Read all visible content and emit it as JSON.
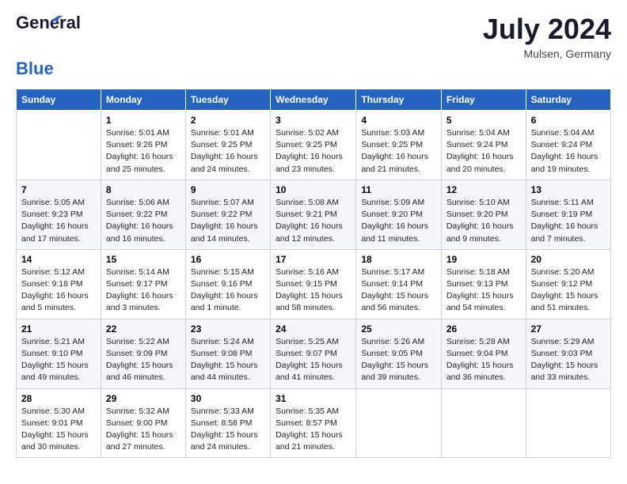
{
  "header": {
    "logo_general": "General",
    "logo_blue": "Blue",
    "month": "July 2024",
    "location": "Mulsen, Germany"
  },
  "columns": [
    "Sunday",
    "Monday",
    "Tuesday",
    "Wednesday",
    "Thursday",
    "Friday",
    "Saturday"
  ],
  "weeks": [
    {
      "cells": [
        {
          "date": "",
          "info": ""
        },
        {
          "date": "1",
          "info": "Sunrise: 5:01 AM\nSunset: 9:26 PM\nDaylight: 16 hours\nand 25 minutes."
        },
        {
          "date": "2",
          "info": "Sunrise: 5:01 AM\nSunset: 9:25 PM\nDaylight: 16 hours\nand 24 minutes."
        },
        {
          "date": "3",
          "info": "Sunrise: 5:02 AM\nSunset: 9:25 PM\nDaylight: 16 hours\nand 23 minutes."
        },
        {
          "date": "4",
          "info": "Sunrise: 5:03 AM\nSunset: 9:25 PM\nDaylight: 16 hours\nand 21 minutes."
        },
        {
          "date": "5",
          "info": "Sunrise: 5:04 AM\nSunset: 9:24 PM\nDaylight: 16 hours\nand 20 minutes."
        },
        {
          "date": "6",
          "info": "Sunrise: 5:04 AM\nSunset: 9:24 PM\nDaylight: 16 hours\nand 19 minutes."
        }
      ]
    },
    {
      "cells": [
        {
          "date": "7",
          "info": "Sunrise: 5:05 AM\nSunset: 9:23 PM\nDaylight: 16 hours\nand 17 minutes."
        },
        {
          "date": "8",
          "info": "Sunrise: 5:06 AM\nSunset: 9:22 PM\nDaylight: 16 hours\nand 16 minutes."
        },
        {
          "date": "9",
          "info": "Sunrise: 5:07 AM\nSunset: 9:22 PM\nDaylight: 16 hours\nand 14 minutes."
        },
        {
          "date": "10",
          "info": "Sunrise: 5:08 AM\nSunset: 9:21 PM\nDaylight: 16 hours\nand 12 minutes."
        },
        {
          "date": "11",
          "info": "Sunrise: 5:09 AM\nSunset: 9:20 PM\nDaylight: 16 hours\nand 11 minutes."
        },
        {
          "date": "12",
          "info": "Sunrise: 5:10 AM\nSunset: 9:20 PM\nDaylight: 16 hours\nand 9 minutes."
        },
        {
          "date": "13",
          "info": "Sunrise: 5:11 AM\nSunset: 9:19 PM\nDaylight: 16 hours\nand 7 minutes."
        }
      ]
    },
    {
      "cells": [
        {
          "date": "14",
          "info": "Sunrise: 5:12 AM\nSunset: 9:18 PM\nDaylight: 16 hours\nand 5 minutes."
        },
        {
          "date": "15",
          "info": "Sunrise: 5:14 AM\nSunset: 9:17 PM\nDaylight: 16 hours\nand 3 minutes."
        },
        {
          "date": "16",
          "info": "Sunrise: 5:15 AM\nSunset: 9:16 PM\nDaylight: 16 hours\nand 1 minute."
        },
        {
          "date": "17",
          "info": "Sunrise: 5:16 AM\nSunset: 9:15 PM\nDaylight: 15 hours\nand 58 minutes."
        },
        {
          "date": "18",
          "info": "Sunrise: 5:17 AM\nSunset: 9:14 PM\nDaylight: 15 hours\nand 56 minutes."
        },
        {
          "date": "19",
          "info": "Sunrise: 5:18 AM\nSunset: 9:13 PM\nDaylight: 15 hours\nand 54 minutes."
        },
        {
          "date": "20",
          "info": "Sunrise: 5:20 AM\nSunset: 9:12 PM\nDaylight: 15 hours\nand 51 minutes."
        }
      ]
    },
    {
      "cells": [
        {
          "date": "21",
          "info": "Sunrise: 5:21 AM\nSunset: 9:10 PM\nDaylight: 15 hours\nand 49 minutes."
        },
        {
          "date": "22",
          "info": "Sunrise: 5:22 AM\nSunset: 9:09 PM\nDaylight: 15 hours\nand 46 minutes."
        },
        {
          "date": "23",
          "info": "Sunrise: 5:24 AM\nSunset: 9:08 PM\nDaylight: 15 hours\nand 44 minutes."
        },
        {
          "date": "24",
          "info": "Sunrise: 5:25 AM\nSunset: 9:07 PM\nDaylight: 15 hours\nand 41 minutes."
        },
        {
          "date": "25",
          "info": "Sunrise: 5:26 AM\nSunset: 9:05 PM\nDaylight: 15 hours\nand 39 minutes."
        },
        {
          "date": "26",
          "info": "Sunrise: 5:28 AM\nSunset: 9:04 PM\nDaylight: 15 hours\nand 36 minutes."
        },
        {
          "date": "27",
          "info": "Sunrise: 5:29 AM\nSunset: 9:03 PM\nDaylight: 15 hours\nand 33 minutes."
        }
      ]
    },
    {
      "cells": [
        {
          "date": "28",
          "info": "Sunrise: 5:30 AM\nSunset: 9:01 PM\nDaylight: 15 hours\nand 30 minutes."
        },
        {
          "date": "29",
          "info": "Sunrise: 5:32 AM\nSunset: 9:00 PM\nDaylight: 15 hours\nand 27 minutes."
        },
        {
          "date": "30",
          "info": "Sunrise: 5:33 AM\nSunset: 8:58 PM\nDaylight: 15 hours\nand 24 minutes."
        },
        {
          "date": "31",
          "info": "Sunrise: 5:35 AM\nSunset: 8:57 PM\nDaylight: 15 hours\nand 21 minutes."
        },
        {
          "date": "",
          "info": ""
        },
        {
          "date": "",
          "info": ""
        },
        {
          "date": "",
          "info": ""
        }
      ]
    }
  ]
}
